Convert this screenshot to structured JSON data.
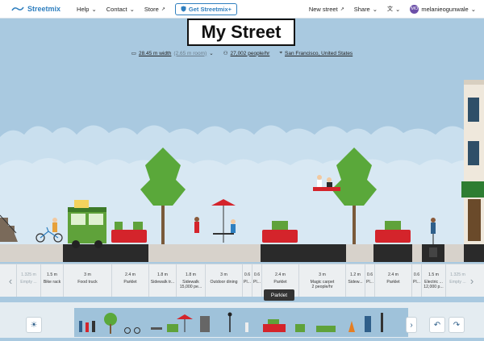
{
  "nav": {
    "brand": "Streetmix",
    "help": "Help",
    "contact": "Contact",
    "store": "Store",
    "get_plus": "Get Streetmix+",
    "new_street": "New street",
    "share": "Share",
    "avatar_initials": "MO",
    "username": "melanieogunwale"
  },
  "street": {
    "title": "My Street",
    "width_value": "28.45 m width",
    "width_remaining": "(2.65 m room)",
    "capacity": "27,002 people/hr",
    "location": "San Francisco, United States"
  },
  "segments": [
    {
      "width": "1.325 m",
      "name": "Empty ...",
      "dim": true
    },
    {
      "width": "1.5 m",
      "name": "Bike rack"
    },
    {
      "width": "3 m",
      "name": "Food truck"
    },
    {
      "width": "2.4 m",
      "name": "Parklet"
    },
    {
      "width": "1.8 m",
      "name": "Sidewalk tr..."
    },
    {
      "width": "1.8 m",
      "name": "Sidewalk",
      "extra": "15,000 pe..."
    },
    {
      "width": "3 m",
      "name": "Outdoor dining"
    },
    {
      "width": "0.6",
      "name": "Pl..."
    },
    {
      "width": "0.6",
      "name": "Pl..."
    },
    {
      "width": "2.4 m",
      "name": "Parklet"
    },
    {
      "width": "3 m",
      "name": "Magic carpet",
      "extra": "2 people/hr"
    },
    {
      "width": "1.2 m",
      "name": "Sidew..."
    },
    {
      "width": "0.6",
      "name": "Pl..."
    },
    {
      "width": "2.4 m",
      "name": "Parklet"
    },
    {
      "width": "0.6",
      "name": "Pl..."
    },
    {
      "width": "1.5 m",
      "name": "Electric ...",
      "extra": "12,000 p..."
    },
    {
      "width": "1.325 m",
      "name": "Empty ...",
      "dim": true
    }
  ],
  "tooltip": "Parklet",
  "palette": {
    "settings_icon": "sun-icon",
    "undo_icon": "undo-icon",
    "redo_icon": "redo-icon",
    "scroll_icon": "chevron-right-icon"
  },
  "colors": {
    "sky": "#a9c9e0",
    "cloud": "#c9dfee",
    "brand": "#2f7fbf",
    "parklet": "#d4242b",
    "food_truck": "#5fa23a",
    "tree": "#5aa83a",
    "sidewalk": "#d7d2cb",
    "roadway": "#2a2a2a"
  }
}
